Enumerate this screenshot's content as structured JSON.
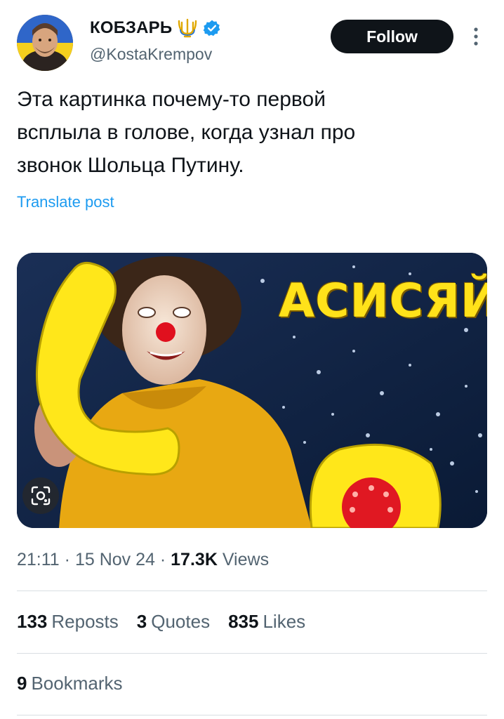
{
  "author": {
    "display_name": "КОБЗАРЬ",
    "handle": "@KostaKrempov",
    "verified": true
  },
  "follow_label": "Follow",
  "tweet": {
    "text_lines": [
      "Эта картинка почему-то первой",
      "всплыла в голове, когда узнал про",
      "звонок Шольца Путину."
    ],
    "translate_label": "Translate post"
  },
  "media": {
    "caption": "АСИСЯЙ"
  },
  "meta": {
    "time": "21:11",
    "date": "15 Nov 24",
    "views_count": "17.3K",
    "views_label": "Views"
  },
  "stats": {
    "reposts_count": "133",
    "reposts_label": "Reposts",
    "quotes_count": "3",
    "quotes_label": "Quotes",
    "likes_count": "835",
    "likes_label": "Likes",
    "bookmarks_count": "9",
    "bookmarks_label": "Bookmarks"
  },
  "colors": {
    "accent": "#1d9bf0",
    "muted_text": "#536471",
    "primary_text": "#0f1419"
  },
  "icons": [
    "trident-icon",
    "verified-icon",
    "more-icon",
    "lens-icon"
  ]
}
